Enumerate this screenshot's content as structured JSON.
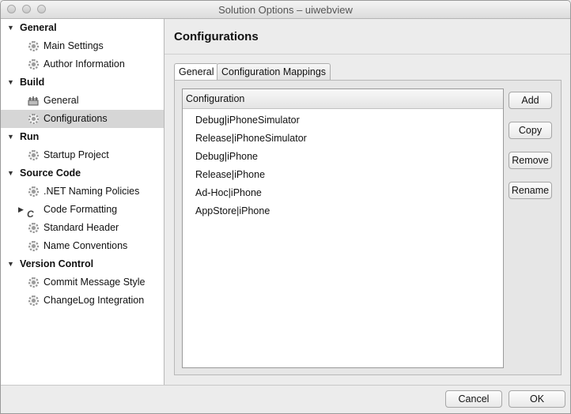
{
  "window": {
    "title": "Solution Options – uiwebview"
  },
  "sidebar": {
    "categories": [
      {
        "label": "General",
        "items": [
          "Main Settings",
          "Author Information"
        ]
      },
      {
        "label": "Build",
        "items": [
          "General",
          "Configurations"
        ]
      },
      {
        "label": "Run",
        "items": [
          "Startup Project"
        ]
      },
      {
        "label": "Source Code",
        "items": [
          ".NET Naming Policies",
          "Code Formatting",
          "Standard Header",
          "Name Conventions"
        ]
      },
      {
        "label": "Version Control",
        "items": [
          "Commit Message Style",
          "ChangeLog Integration"
        ]
      }
    ],
    "selected_item": "Configurations"
  },
  "main": {
    "title": "Configurations",
    "tabs": [
      {
        "label": "General",
        "active": true
      },
      {
        "label": "Configuration Mappings",
        "active": false
      }
    ],
    "list": {
      "column_header": "Configuration",
      "rows": [
        "Debug|iPhoneSimulator",
        "Release|iPhoneSimulator",
        "Debug|iPhone",
        "Release|iPhone",
        "Ad-Hoc|iPhone",
        "AppStore|iPhone"
      ]
    },
    "buttons": {
      "add": "Add",
      "copy": "Copy",
      "remove": "Remove",
      "rename": "Rename"
    }
  },
  "footer": {
    "cancel": "Cancel",
    "ok": "OK"
  }
}
